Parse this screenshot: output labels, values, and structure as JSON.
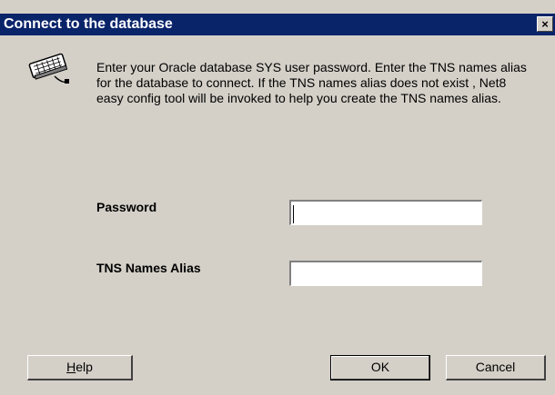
{
  "window": {
    "title": "Connect to the database",
    "close_glyph": "×"
  },
  "icon": "keyboard-icon",
  "description": "Enter your Oracle database SYS user password. Enter the TNS names alias for the database to connect. If the TNS names alias does not exist , Net8 easy config tool will be invoked to help you create the TNS names alias.",
  "form": {
    "password_label": "Password",
    "password_value": "",
    "tns_label": "TNS Names Alias",
    "tns_value": ""
  },
  "buttons": {
    "help_mnemonic": "H",
    "help_rest": "elp",
    "ok": "OK",
    "cancel": "Cancel"
  },
  "colors": {
    "titlebar": "#0a246a",
    "dialog_bg": "#d4d0c8"
  }
}
